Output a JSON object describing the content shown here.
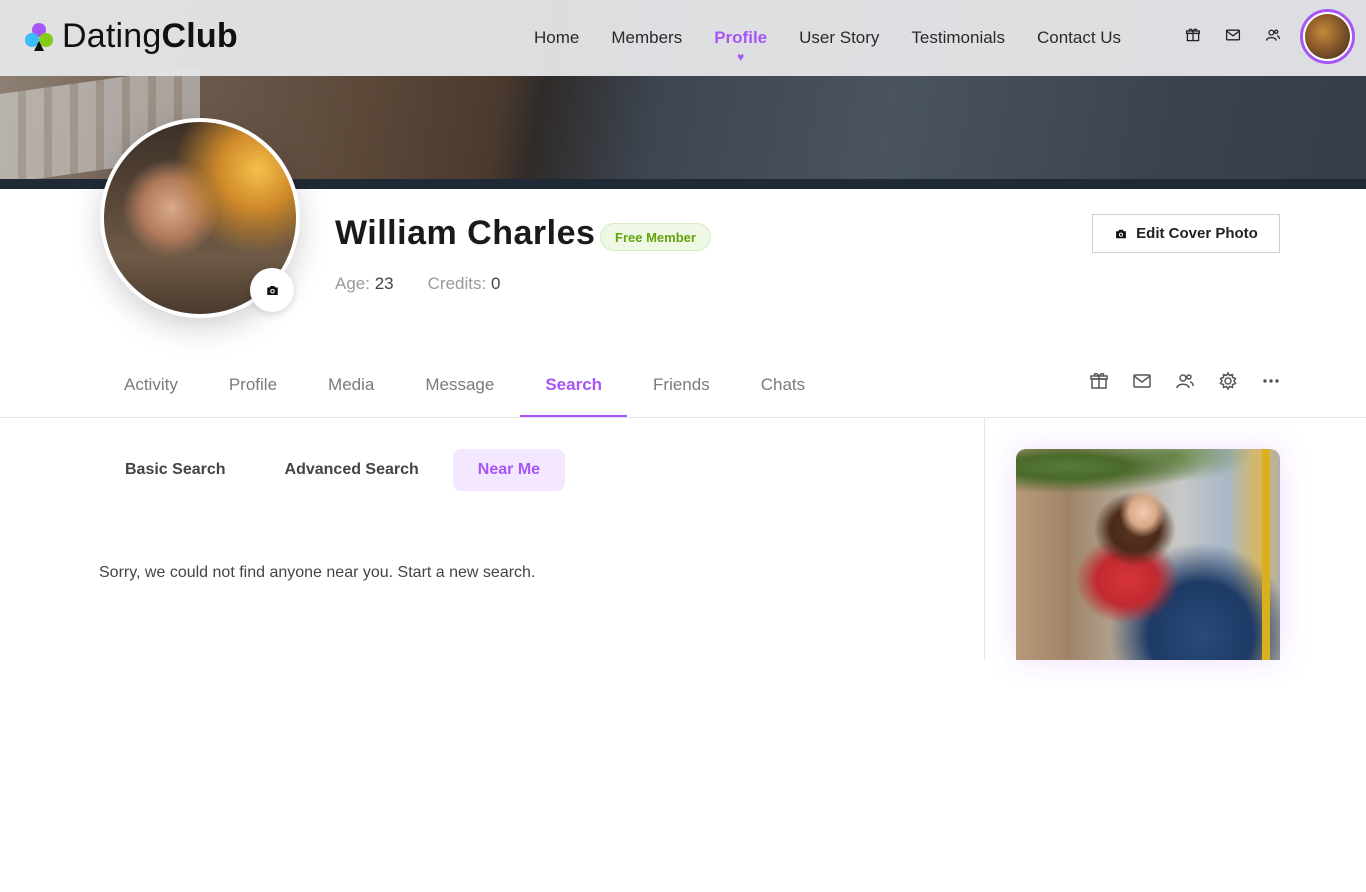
{
  "brand": {
    "name_regular": "Dating",
    "name_bold": "Club"
  },
  "nav": {
    "items": [
      {
        "label": "Home",
        "active": false
      },
      {
        "label": "Members",
        "active": false
      },
      {
        "label": "Profile",
        "active": true
      },
      {
        "label": "User Story",
        "active": false
      },
      {
        "label": "Testimonials",
        "active": false
      },
      {
        "label": "Contact Us",
        "active": false
      }
    ],
    "icons": [
      "gift-icon",
      "mail-icon",
      "users-icon"
    ]
  },
  "profile": {
    "name": "William Charles",
    "membership_badge": "Free Member",
    "age_label": "Age:",
    "age_value": "23",
    "credits_label": "Credits:",
    "credits_value": "0",
    "edit_cover_label": "Edit Cover Photo"
  },
  "tabs": {
    "items": [
      {
        "label": "Activity",
        "active": false
      },
      {
        "label": "Profile",
        "active": false
      },
      {
        "label": "Media",
        "active": false
      },
      {
        "label": "Message",
        "active": false
      },
      {
        "label": "Search",
        "active": true
      },
      {
        "label": "Friends",
        "active": false
      },
      {
        "label": "Chats",
        "active": false
      }
    ],
    "icons": [
      "gift-icon",
      "mail-icon",
      "users-icon",
      "gear-icon",
      "more-icon"
    ]
  },
  "search": {
    "subtabs": [
      {
        "label": "Basic Search",
        "active": false
      },
      {
        "label": "Advanced Search",
        "active": false
      },
      {
        "label": "Near Me",
        "active": true
      }
    ],
    "empty_message": "Sorry, we could not find anyone near you. Start a new search."
  },
  "colors": {
    "accent": "#a855f7",
    "badge_text": "#65a30d",
    "badge_bg": "#eef8e4"
  }
}
